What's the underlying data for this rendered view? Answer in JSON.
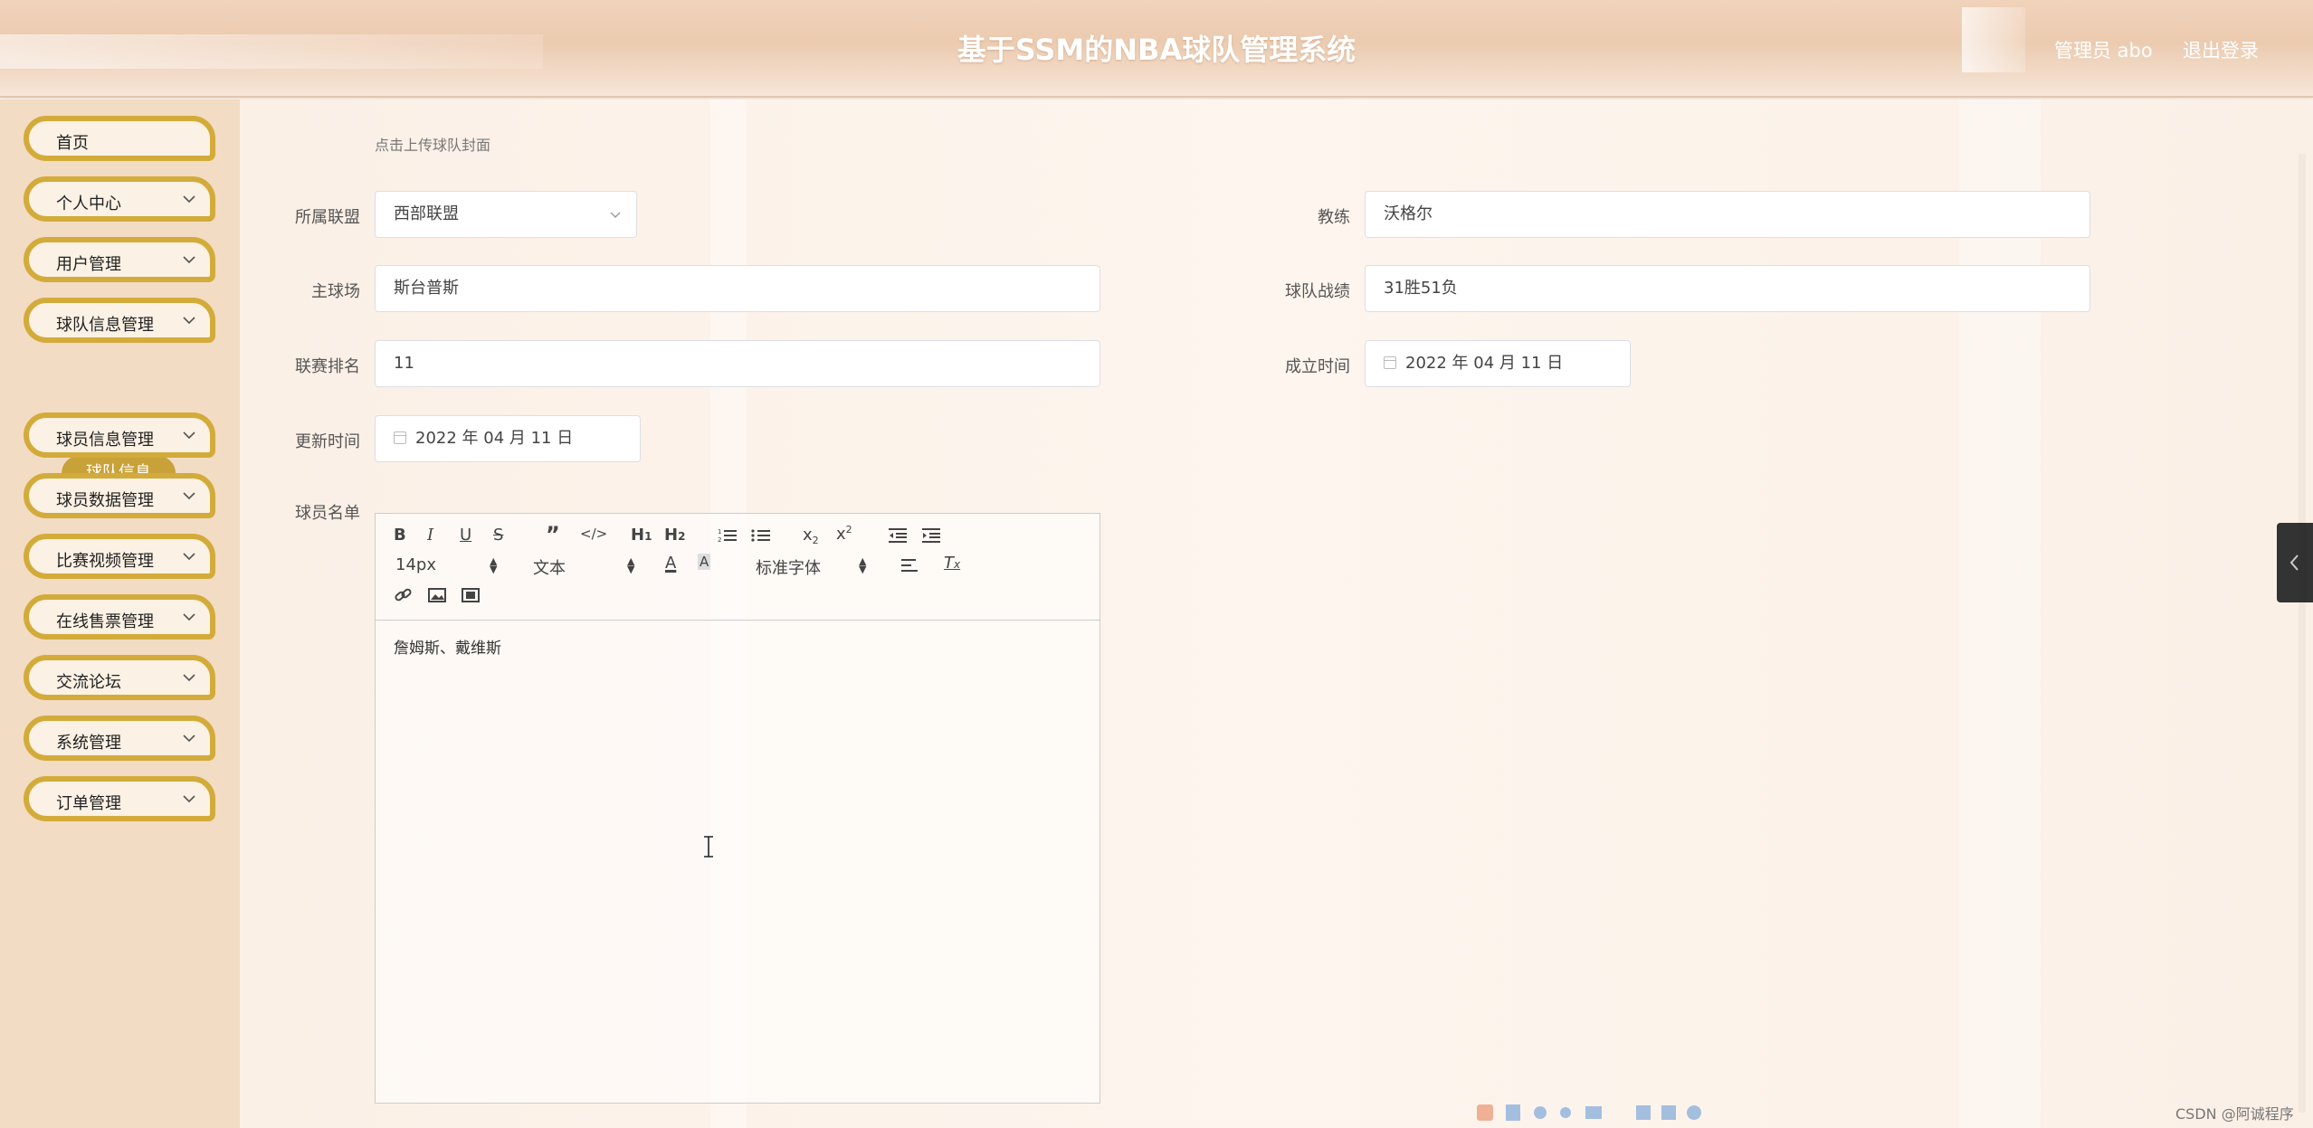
{
  "header": {
    "title": "基于SSM的NBA球队管理系统",
    "user": "管理员 abo",
    "logout": "退出登录"
  },
  "sidebar": {
    "items": [
      {
        "label": "首页",
        "has_arrow": false
      },
      {
        "label": "个人中心",
        "has_arrow": true
      },
      {
        "label": "用户管理",
        "has_arrow": true
      },
      {
        "label": "球队信息管理",
        "has_arrow": true
      },
      {
        "label": "球员信息管理",
        "has_arrow": true
      },
      {
        "label": "球员数据管理",
        "has_arrow": true
      },
      {
        "label": "比赛视频管理",
        "has_arrow": true
      },
      {
        "label": "在线售票管理",
        "has_arrow": true
      },
      {
        "label": "交流论坛",
        "has_arrow": true
      },
      {
        "label": "系统管理",
        "has_arrow": true
      },
      {
        "label": "订单管理",
        "has_arrow": true
      }
    ],
    "active_sub": "球队信息"
  },
  "form": {
    "upload_hint": "点击上传球队封面",
    "league": {
      "label": "所属联盟",
      "value": "西部联盟"
    },
    "coach": {
      "label": "教练",
      "value": "沃格尔"
    },
    "arena": {
      "label": "主球场",
      "value": "斯台普斯"
    },
    "record": {
      "label": "球队战绩",
      "value": "31胜51负"
    },
    "rank": {
      "label": "联赛排名",
      "value": "11"
    },
    "founded": {
      "label": "成立时间",
      "value": "2022 年 04 月 11 日"
    },
    "updated": {
      "label": "更新时间",
      "value": "2022 年 04 月 11 日"
    },
    "roster": {
      "label": "球员名单",
      "content": "詹姆斯、戴维斯"
    }
  },
  "editor_toolbar": {
    "font_size": "14px",
    "text_style": "文本",
    "font_family": "标准字体"
  },
  "watermark": "CSDN @阿诚程序"
}
